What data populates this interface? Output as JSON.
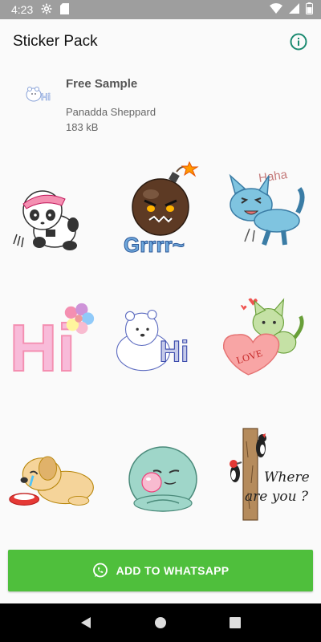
{
  "status_bar": {
    "time": "4:23"
  },
  "app_bar": {
    "title": "Sticker Pack"
  },
  "pack": {
    "name": "Free Sample",
    "publisher": "Panadda Sheppard",
    "size": "183 kB"
  },
  "stickers": [
    {
      "icon": "panda-running-sticker"
    },
    {
      "icon": "angry-bomb-sticker",
      "text": "Grrrr~"
    },
    {
      "icon": "blue-cat-laughing-sticker",
      "text": "Haha"
    },
    {
      "icon": "pink-hi-sticker",
      "text": "Hi"
    },
    {
      "icon": "polar-bear-hi-sticker",
      "text": "Hi"
    },
    {
      "icon": "green-cat-love-heart-sticker",
      "text": "LOVE"
    },
    {
      "icon": "crying-puppy-sticker"
    },
    {
      "icon": "bubblegum-seal-sticker"
    },
    {
      "icon": "woodpecker-where-are-you-sticker",
      "text_line1": "Where",
      "text_line2": "are you ?"
    }
  ],
  "cta": {
    "label": "ADD TO WHATSAPP"
  },
  "colors": {
    "accent": "#4fbf3c",
    "info_icon": "#1a8a70",
    "status_bar": "#9e9e9e"
  }
}
